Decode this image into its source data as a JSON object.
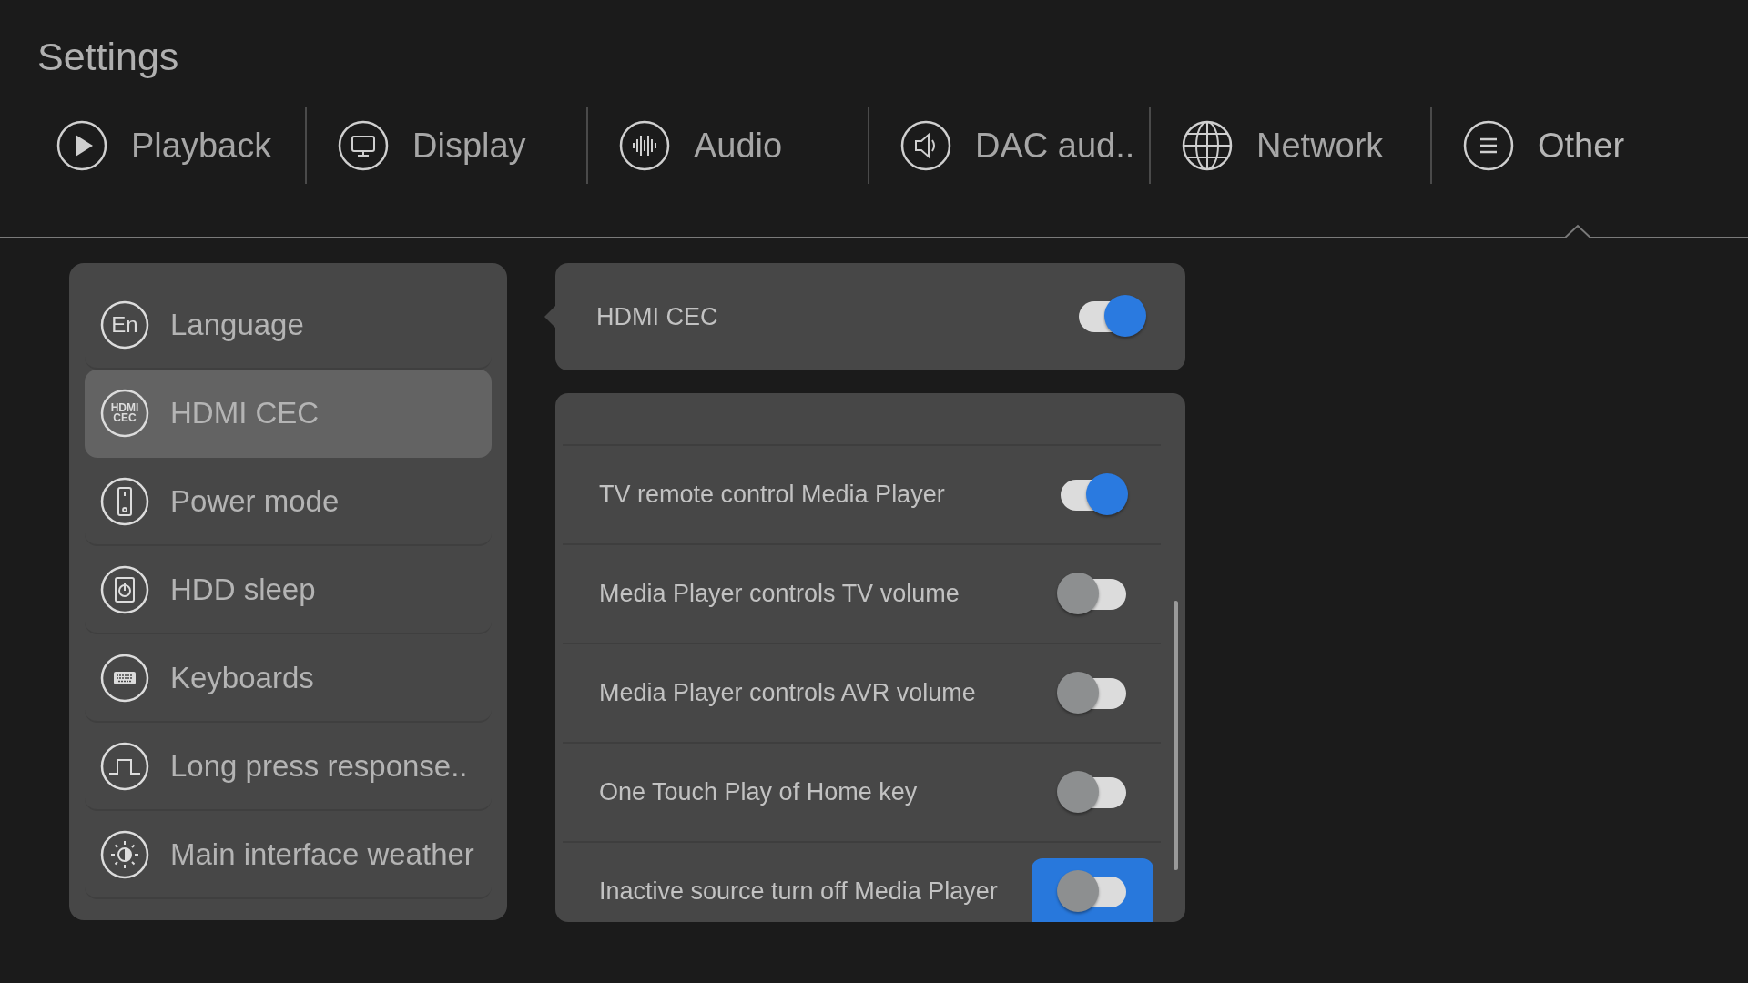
{
  "title": "Settings",
  "tabs": [
    {
      "label": "Playback",
      "kind": "play",
      "selected": false
    },
    {
      "label": "Display",
      "kind": "monitor",
      "selected": false
    },
    {
      "label": "Audio",
      "kind": "wave",
      "selected": false
    },
    {
      "label": "DAC aud..",
      "kind": "speaker",
      "selected": false
    },
    {
      "label": "Network",
      "kind": "globe",
      "selected": false
    },
    {
      "label": "Other",
      "kind": "list",
      "selected": true
    }
  ],
  "menu": [
    {
      "label": "Language",
      "kind": "text",
      "icon_text": [
        "En"
      ],
      "selected": false
    },
    {
      "label": "HDMI CEC",
      "kind": "text",
      "icon_text": [
        "HDMI",
        "CEC"
      ],
      "selected": true
    },
    {
      "label": "Power mode",
      "kind": "remote",
      "selected": false
    },
    {
      "label": "HDD sleep",
      "kind": "drive",
      "selected": false
    },
    {
      "label": "Keyboards",
      "kind": "keyboard",
      "selected": false
    },
    {
      "label": "Long press response..",
      "kind": "pulse",
      "selected": false
    },
    {
      "label": "Main interface weather",
      "kind": "brightness",
      "selected": false
    }
  ],
  "main_setting": {
    "label": "HDMI CEC",
    "on": true
  },
  "options": [
    {
      "label": "TV remote control Media Player",
      "on": true,
      "focused": false
    },
    {
      "label": "Media Player controls TV volume",
      "on": false,
      "focused": false
    },
    {
      "label": "Media Player controls AVR volume",
      "on": false,
      "focused": false
    },
    {
      "label": "One Touch Play of Home key",
      "on": false,
      "focused": false
    },
    {
      "label": "Inactive source turn off Media Player",
      "on": false,
      "focused": true
    }
  ]
}
